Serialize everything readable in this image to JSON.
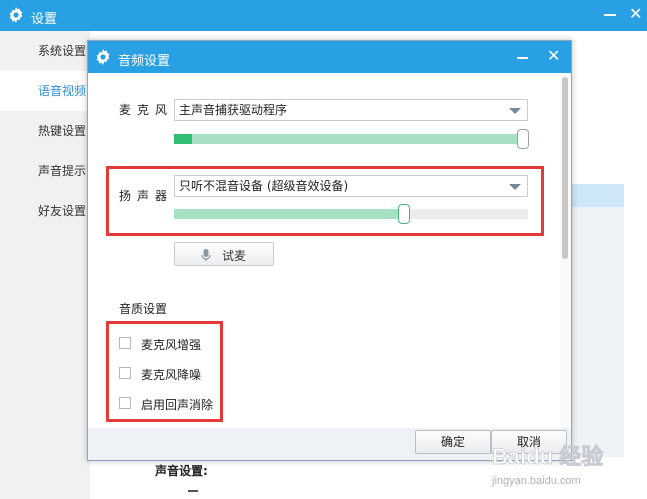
{
  "background_window": {
    "title": "设置",
    "sidebar": [
      {
        "label": "系统设置",
        "active": false
      },
      {
        "label": "语音视频",
        "active": true
      },
      {
        "label": "热键设置",
        "active": false
      },
      {
        "label": "声音提示",
        "active": false
      },
      {
        "label": "好友设置",
        "active": false
      }
    ],
    "bottom_label": "声音设置:"
  },
  "dialog": {
    "title": "音频设置",
    "microphone": {
      "label": "麦克风",
      "device": "主声音捕获驱动程序",
      "level": 0.05
    },
    "speaker": {
      "label": "扬声器",
      "device": "只听不混音设备 (超级音效设备)",
      "volume": 0.65
    },
    "test_button": "试麦",
    "quality_section": "音质设置",
    "options": [
      {
        "label": "麦克风增强",
        "checked": false
      },
      {
        "label": "麦克风降噪",
        "checked": false
      },
      {
        "label": "启用回声消除",
        "checked": false
      }
    ],
    "ok_button": "确定",
    "cancel_button": "取消"
  },
  "watermark": {
    "brand": "Baidu 经验",
    "url": "jingyan.baidu.com"
  },
  "colors": {
    "titlebar": "#2aa0e4",
    "highlight": "#e53a3a",
    "level_fill": "#2fbe73",
    "level_track": "#a8e0c4"
  }
}
